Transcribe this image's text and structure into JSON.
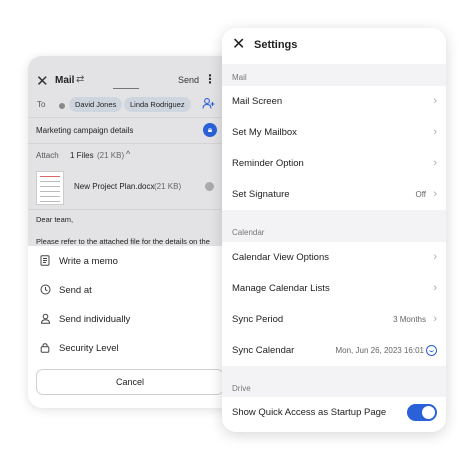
{
  "mail": {
    "title": "Mail",
    "send_label": "Send",
    "to_label": "To",
    "recipients": [
      "David Jones",
      "Linda Rodriguez"
    ],
    "subject": "Marketing campaign details",
    "attach_label": "Attach",
    "files_count": "1 Files",
    "files_total_size": "(21 KB)",
    "file": {
      "name": "New Project Plan.docx",
      "size": "(21 KB)"
    },
    "body_line1": "Dear team,",
    "body_line2": "Please refer to the attached file for the details on the"
  },
  "action_sheet": {
    "items": [
      {
        "label": "Write a memo",
        "icon": "memo-icon"
      },
      {
        "label": "Send at",
        "icon": "clock-icon"
      },
      {
        "label": "Send individually",
        "icon": "person-icon"
      },
      {
        "label": "Security Level",
        "icon": "lock-icon"
      }
    ],
    "cancel_label": "Cancel"
  },
  "settings": {
    "title": "Settings",
    "sections": {
      "mail": {
        "label": "Mail",
        "rows": [
          {
            "label": "Mail Screen",
            "value": ""
          },
          {
            "label": "Set My Mailbox",
            "value": ""
          },
          {
            "label": "Reminder Option",
            "value": ""
          },
          {
            "label": "Set Signature",
            "value": "Off"
          }
        ]
      },
      "calendar": {
        "label": "Calendar",
        "rows": [
          {
            "label": "Calendar View Options",
            "value": ""
          },
          {
            "label": "Manage Calendar Lists",
            "value": ""
          },
          {
            "label": "Sync Period",
            "value": "3 Months"
          },
          {
            "label": "Sync Calendar",
            "value": "Mon, Jun 26, 2023 16:01"
          }
        ]
      },
      "drive": {
        "label": "Drive",
        "rows": [
          {
            "label": "Show Quick Access as Startup Page",
            "toggle_on": true
          }
        ]
      }
    }
  },
  "colors": {
    "accent": "#2a61d8",
    "chip_bg": "#cfd5df"
  }
}
